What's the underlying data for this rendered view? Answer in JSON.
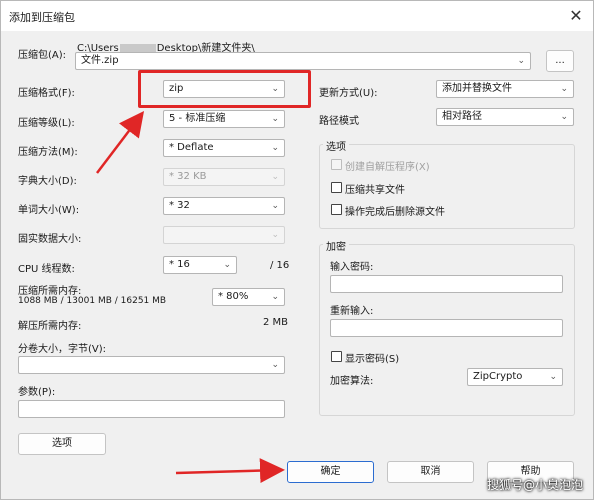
{
  "window": {
    "title": "添加到压缩包",
    "close_label": "✕"
  },
  "archive": {
    "label": "压缩包(A):",
    "path_prefix": "C:\\Users",
    "path_suffix": "Desktop\\新建文件夹\\",
    "filename": "文件.zip",
    "browse_label": "..."
  },
  "left": {
    "format": {
      "label": "压缩格式(F):",
      "value": "zip"
    },
    "level": {
      "label": "压缩等级(L):",
      "value": "5 - 标准压缩"
    },
    "method": {
      "label": "压缩方法(M):",
      "value": "* Deflate"
    },
    "dict": {
      "label": "字典大小(D):",
      "value": "* 32 KB"
    },
    "word": {
      "label": "单词大小(W):",
      "value": "* 32"
    },
    "solid": {
      "label": "固实数据大小:",
      "value": ""
    },
    "threads": {
      "label": "CPU 线程数:",
      "value": "* 16",
      "max": "/ 16"
    },
    "mem_compress": {
      "label": "压缩所需内存:",
      "detail": "1088 MB / 13001 MB / 16251 MB",
      "value": "* 80%"
    },
    "mem_decompress": {
      "label": "解压所需内存:",
      "value": "2 MB"
    },
    "split": {
      "label": "分卷大小，字节(V):",
      "value": ""
    },
    "params": {
      "label": "参数(P):",
      "value": ""
    },
    "options_button": "选项"
  },
  "right": {
    "update": {
      "label": "更新方式(U):",
      "value": "添加并替换文件"
    },
    "path_mode": {
      "label": "路径模式",
      "value": "相对路径"
    },
    "options_group": {
      "title": "选项",
      "sfx": "创建自解压程序(X)",
      "shared": "压缩共享文件",
      "delete": "操作完成后删除源文件"
    },
    "encryption": {
      "title": "加密",
      "password_label": "输入密码:",
      "reenter_label": "重新输入:",
      "show_password": "显示密码(S)",
      "method_label": "加密算法:",
      "method_value": "ZipCrypto"
    }
  },
  "buttons": {
    "ok": "确定",
    "cancel": "取消",
    "help": "帮助"
  },
  "annotation": {
    "color": "#e02626"
  },
  "watermark": "搜狐号@小臭泡泡"
}
